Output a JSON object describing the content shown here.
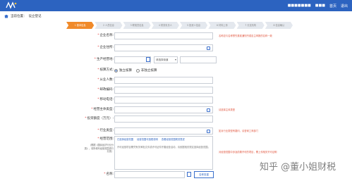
{
  "header": {
    "user_name": "■■■■■■■",
    "user_links": [
      "■■■",
      "首页",
      "退出"
    ]
  },
  "breadcrumb": {
    "prefix": "当前位置：",
    "current": "设立登记"
  },
  "steps": [
    {
      "label": "1 基本信息",
      "active": true
    },
    {
      "label": "2 人员信息",
      "active": false
    },
    {
      "label": "3 联络员信息",
      "active": false
    },
    {
      "label": "4 财务负责人",
      "active": false
    },
    {
      "label": "5 投资人信息",
      "active": false
    },
    {
      "label": "6 材料上传",
      "active": false
    },
    {
      "label": "7 分支机构",
      "active": false
    },
    {
      "label": "8 信息确认",
      "active": false
    }
  ],
  "form": {
    "company_name_label": "企业名称:",
    "company_name_hint": "名称应与名称预先核准通知书或自主申报的名称一致",
    "residence_label": "企业住所:",
    "business_place_label": "生产经营地:",
    "place_select": "请选择街道",
    "accounting_label": "核算方式:",
    "accounting_options": [
      "独立核算",
      "非独立核算"
    ],
    "employees_label": "从业人数:",
    "postcode_label": "邮政编码:",
    "phone_label": "移动电话:",
    "main_business_label": "经营主体类型:",
    "main_business_hint": "请选择主体类型",
    "capital_label": "投资额度（万元）:",
    "industry_label": "行业类型:",
    "industry_hint": "如对行业类型有疑问，请咨询工商部门",
    "scope_label": "经营范围:",
    "scope_sublabel": "（根据《国民经济行业分类》，将所填写经营范围进行分类）",
    "scope_links": [
      "已选择经营范围",
      "经营范围可选框说明",
      "查看经营范围规范表述"
    ],
    "scope_text": "许可经营项目需凭有关审批文件或许可证件开展经营活动，请依据相关规定选择经营范围。",
    "scope_hint": "对经营范围中涉及前置许可的项目，需上传相关许可证明",
    "name_label": "名称:",
    "name_check_button": "名称查重"
  },
  "watermark": "知乎 @董小姐财税"
}
